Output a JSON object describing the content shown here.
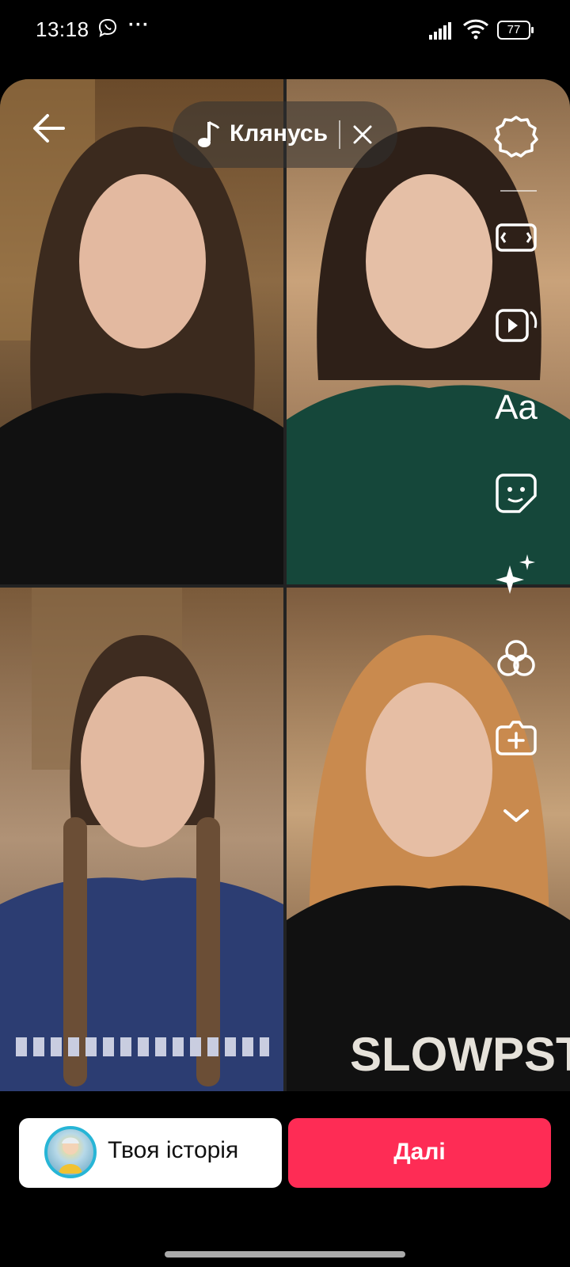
{
  "status_bar": {
    "time": "13:18",
    "dots": "···",
    "battery": "77",
    "icons": [
      "viber-icon",
      "signal-icon",
      "wifi-icon",
      "battery-icon"
    ]
  },
  "header": {
    "sound_name": "Клянусь",
    "icons": [
      "back-arrow-icon",
      "music-note-icon",
      "close-icon"
    ]
  },
  "preview": {
    "panels": [
      {
        "hair": "wavy brunette",
        "top": "black tank top"
      },
      {
        "hair": "bob dark brown",
        "top": "green t-shirt"
      },
      {
        "hair": "braids",
        "top": "blue patterned top"
      },
      {
        "hair": "long ginger",
        "top": "black t-shirt"
      }
    ]
  },
  "toolbar": {
    "text_tool_label": "Aa",
    "icons": [
      "settings-icon",
      "resize-icon",
      "template-icon",
      "text-icon",
      "sticker-icon",
      "effects-icon",
      "filters-icon",
      "add-overlay-icon",
      "expand-chevron-icon"
    ]
  },
  "footer": {
    "story_label": "Твоя історія",
    "next_label": "Далі"
  },
  "colors": {
    "accent": "#fe2c55",
    "avatar_ring": "#27b5d6",
    "background": "#000000"
  }
}
